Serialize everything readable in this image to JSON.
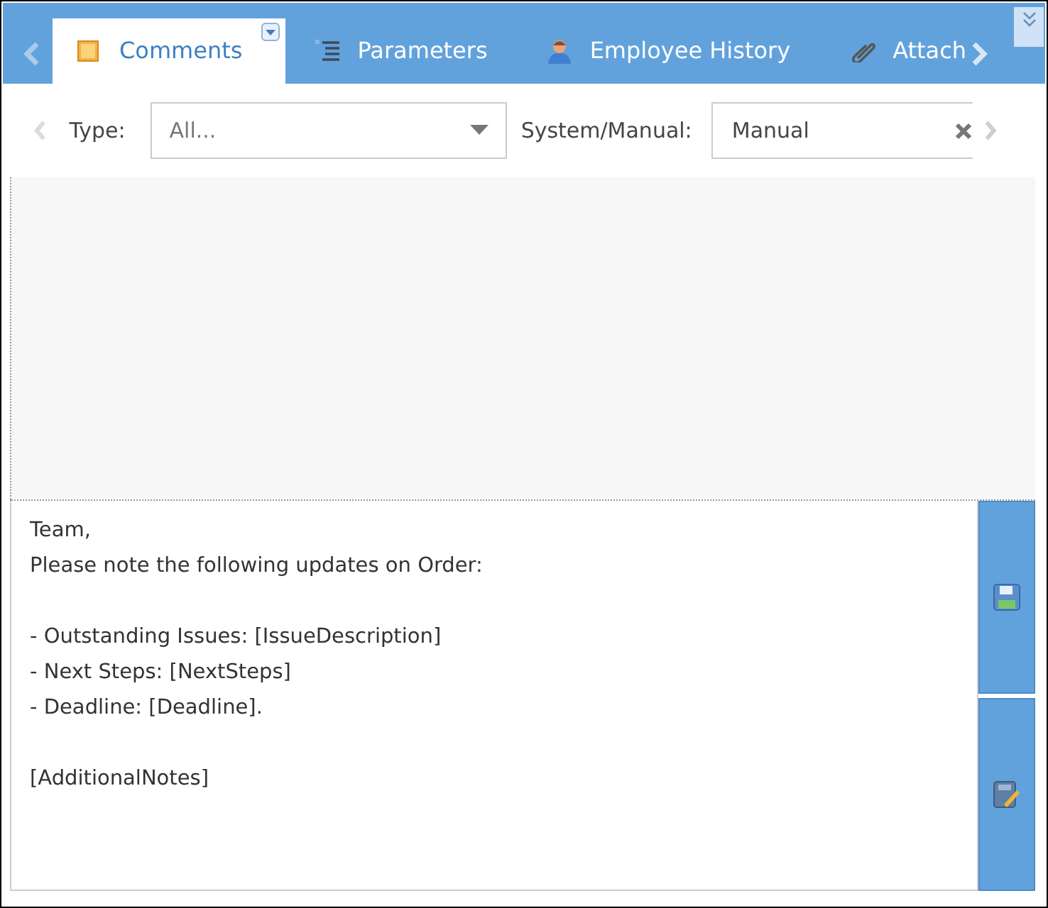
{
  "tabs": [
    {
      "label": "Comments",
      "kind": "note",
      "selected": true
    },
    {
      "label": "Parameters",
      "kind": "list",
      "selected": false
    },
    {
      "label": "Employee History",
      "kind": "person",
      "selected": false
    },
    {
      "label": "Attach",
      "kind": "clip",
      "selected": false
    }
  ],
  "filters": {
    "type_label": "Type:",
    "type_value": "All...",
    "system_label": "System/Manual:",
    "system_value": "Manual"
  },
  "comment_text": "Team,\nPlease note the following updates on Order:\n\n- Outstanding Issues: [IssueDescription]\n- Next Steps: [NextSteps]\n- Deadline: [Deadline].\n\n[AdditionalNotes]"
}
